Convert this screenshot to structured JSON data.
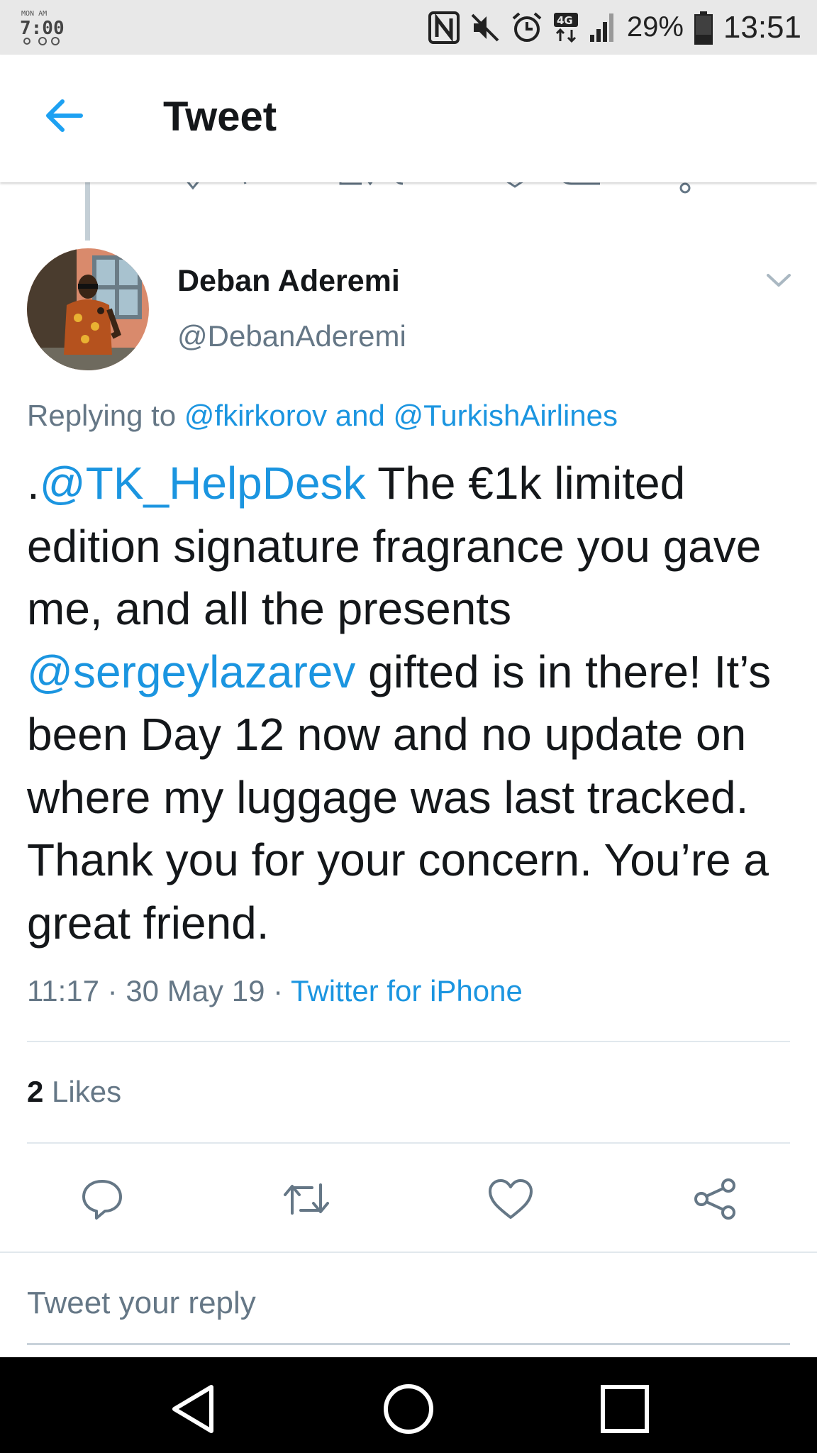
{
  "status_bar": {
    "left_glyph": "7:00",
    "battery_percent": "29%",
    "time": "13:51",
    "network": "4G",
    "icons": [
      "nfc-icon",
      "mute-icon",
      "alarm-icon",
      "network-4g-icon",
      "signal-icon",
      "battery-icon"
    ]
  },
  "header": {
    "title": "Tweet",
    "back_icon": "back-arrow-icon"
  },
  "tweet": {
    "author_name": "Deban Aderemi",
    "author_handle": "@DebanAderemi",
    "replying_prefix": "Replying to",
    "replying_user1": "@fkirkorov",
    "replying_and": "and",
    "replying_user2": "@TurkishAirlines",
    "text_lead": ".",
    "mention1": "@TK_HelpDesk",
    "text_part1": " The €1k limited edition signature fragrance you gave me, and all the presents ",
    "mention2": "@sergeylazarev",
    "text_part2": " gifted is in there! It’s been Day 12 now and no update on where my luggage was last tracked. Thank you for your concern. You’re a great friend.",
    "time": "11:17",
    "sep1": " · ",
    "date": "30 May 19",
    "sep2": " · ",
    "source": "Twitter for iPhone"
  },
  "engagement": {
    "likes_count": "2",
    "likes_label": "Likes"
  },
  "actions": [
    "reply-icon",
    "retweet-icon",
    "like-icon",
    "share-icon"
  ],
  "reply_box": {
    "placeholder": "Tweet your reply"
  },
  "navbar": [
    "back-triangle-icon",
    "home-circle-icon",
    "recents-square-icon"
  ],
  "colors": {
    "link": "#1b95e0",
    "secondary_text": "#657786",
    "primary_text": "#14171a",
    "status_bar_bg": "#e8e8e8",
    "nav_bg": "#000000"
  }
}
